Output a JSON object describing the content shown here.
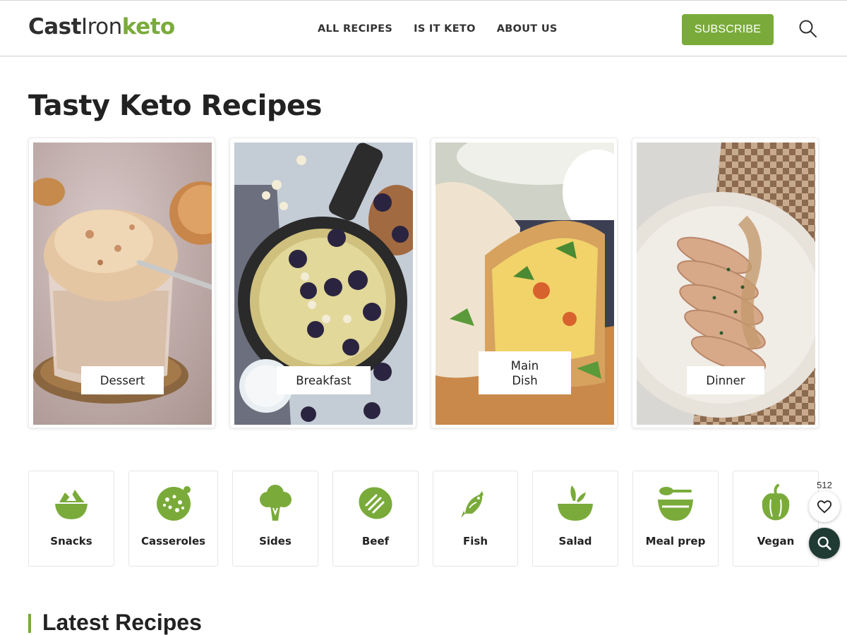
{
  "brand": {
    "logo_part1": "Cast",
    "logo_part2": "Iron",
    "logo_part3": "keto",
    "accent_color": "#7aab3a"
  },
  "nav": {
    "items": [
      {
        "label": "ALL RECIPES"
      },
      {
        "label": "IS IT KETO"
      },
      {
        "label": "ABOUT US"
      }
    ],
    "subscribe_label": "SUBSCRIBE",
    "search_icon": "search-icon"
  },
  "main": {
    "title": "Tasty Keto Recipes",
    "featured": [
      {
        "label": "Dessert",
        "image": "ice-cream-glass"
      },
      {
        "label": "Breakfast",
        "image": "skillet-blackberry-pancake"
      },
      {
        "label": "Main\nDish",
        "image": "quesadilla-wrap"
      },
      {
        "label": "Dinner",
        "image": "sliced-turkey-gravy"
      }
    ],
    "categories": [
      {
        "label": "Snacks",
        "icon": "snack-bowl-icon"
      },
      {
        "label": "Casseroles",
        "icon": "casserole-icon"
      },
      {
        "label": "Sides",
        "icon": "broccoli-icon"
      },
      {
        "label": "Beef",
        "icon": "steak-icon"
      },
      {
        "label": "Fish",
        "icon": "fish-icon"
      },
      {
        "label": "Salad",
        "icon": "salad-bowl-icon"
      },
      {
        "label": "Meal prep",
        "icon": "meal-prep-icon"
      },
      {
        "label": "Vegan",
        "icon": "pepper-icon"
      }
    ],
    "latest_title": "Latest Recipes"
  },
  "floating": {
    "favorite_count": "512",
    "favorite_icon": "heart-icon",
    "search_icon": "search-icon"
  }
}
